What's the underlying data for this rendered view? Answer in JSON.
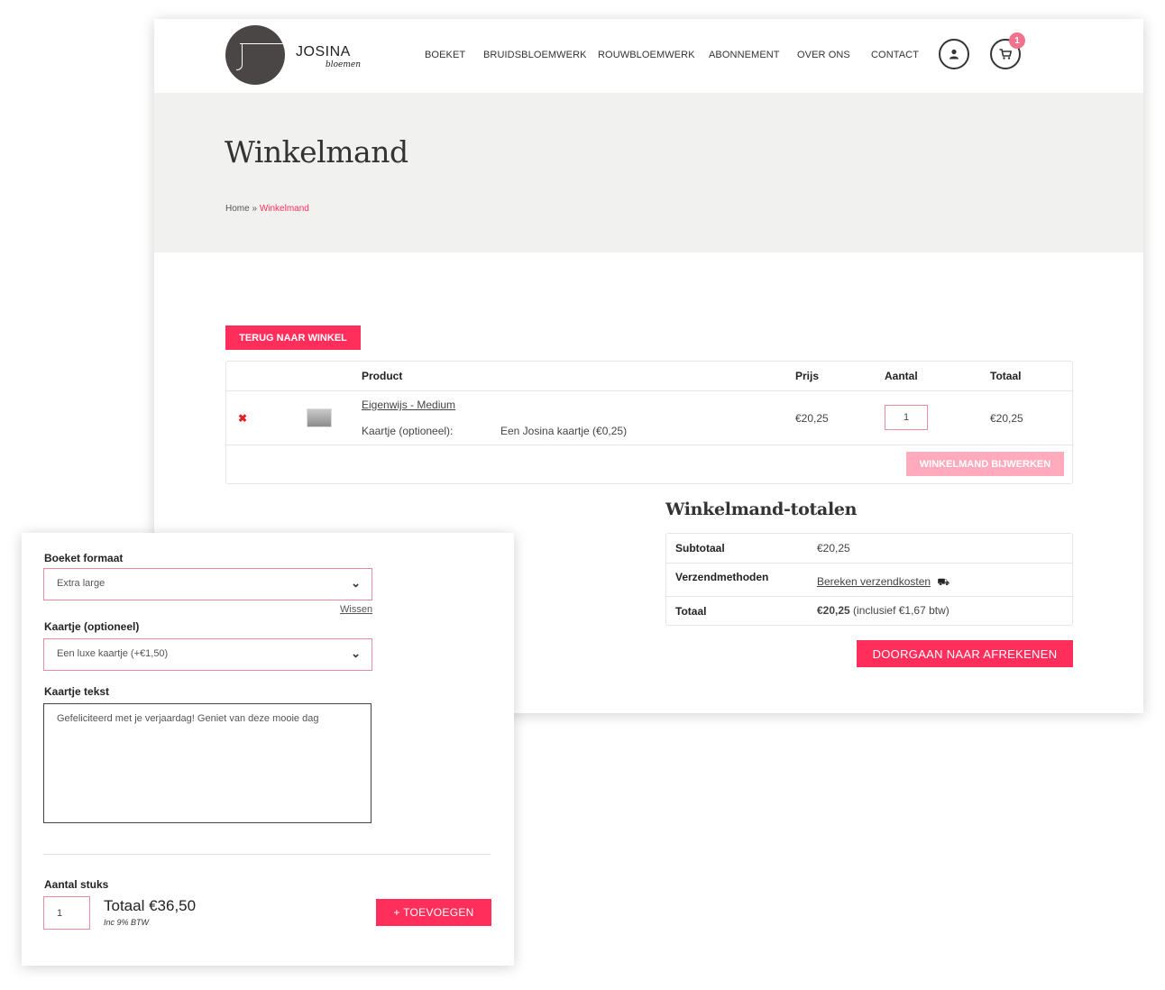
{
  "colors": {
    "accent": "#ff2e5b",
    "accent_light": "#ffabbd",
    "banner_bg": "#f1f1ef",
    "logo_bg": "#4a4646"
  },
  "logo": {
    "name": "JOSINA",
    "subtitle": "bloemen",
    "mark": "j"
  },
  "nav": {
    "items": [
      "BOEKET",
      "BRUIDSBLOEMWERK",
      "ROUWBLOEMWERK",
      "ABONNEMENT",
      "OVER ONS",
      "CONTACT"
    ],
    "account_icon": "user-icon",
    "cart_icon": "cart-icon",
    "cart_count": "1"
  },
  "page": {
    "title": "Winkelmand",
    "breadcrumb": {
      "home": "Home",
      "sep": " » ",
      "current": "Winkelmand"
    },
    "back_button": "TERUG NAAR WINKEL"
  },
  "cart": {
    "headers": {
      "product": "Product",
      "price": "Prijs",
      "qty": "Aantal",
      "total": "Totaal"
    },
    "items": [
      {
        "name": "Eigenwijs - Medium",
        "meta_label": "Kaartje (optioneel):",
        "meta_value": "Een Josina kaartje (€0,25)",
        "price": "€20,25",
        "qty": "1",
        "total": "€20,25",
        "remove_icon": "remove-x-icon"
      }
    ],
    "update_button": "WINKELMAND BIJWERKEN"
  },
  "totals": {
    "title": "Winkelmand-totalen",
    "subtotal_label": "Subtotaal",
    "subtotal_value": "€20,25",
    "shipping_label": "Verzendmethoden",
    "shipping_link": "Bereken verzendkosten",
    "shipping_icon": "truck-icon",
    "total_label": "Totaal",
    "total_value": "€20,25",
    "total_tax": "(inclusief €1,67 btw)",
    "checkout_button": "DOORGAAN NAAR AFREKENEN"
  },
  "product_form": {
    "format_label": "Boeket formaat",
    "format_value": "Extra large",
    "clear_link": "Wissen",
    "card_label": "Kaartje (optioneel)",
    "card_value": "Een luxe kaartje (+€1,50)",
    "card_text_label": "Kaartje tekst",
    "card_text_value": "Gefeliciteerd met je verjaardag! Geniet van deze mooie dag",
    "qty_label": "Aantal stuks",
    "qty_value": "1",
    "total": "Totaal €36,50",
    "btw_note": "Inc 9% BTW",
    "add_button": "+ TOEVOEGEN"
  }
}
